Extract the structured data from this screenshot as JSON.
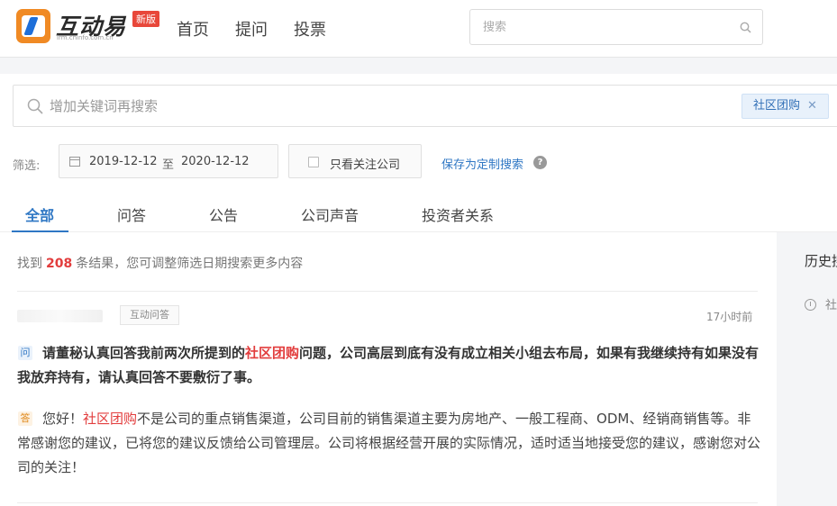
{
  "header": {
    "logo_text": "互动易",
    "logo_sub": "irm.cninfo.com.cn",
    "logo_badge": "新版",
    "nav": [
      "首页",
      "提问",
      "投票"
    ],
    "search_placeholder": "搜索"
  },
  "keyword_search": {
    "placeholder": "增加关键词再搜索",
    "tag": "社区团购",
    "tag_close": "✕"
  },
  "filter": {
    "label": "筛选:",
    "date_from": "2019-12-12",
    "date_sep": "至",
    "date_to": "2020-12-12",
    "follow_only": "只看关注公司",
    "save_link": "保存为定制搜索",
    "help": "?"
  },
  "tabs": [
    "全部",
    "问答",
    "公告",
    "公司声音",
    "投资者关系"
  ],
  "results": {
    "prefix": "找到",
    "count": "208",
    "suffix": "条结果，您可调整筛选日期搜索更多内容"
  },
  "item": {
    "source": "互动问答",
    "time": "17小时前",
    "q_icon": "问",
    "question_before": "请董秘认真回答我前两次所提到的",
    "question_keyword": "社区团购",
    "question_after": "问题，公司高层到底有没有成立相关小组去布局，如果有我继续持有如果没有我放弃持有，请认真回答不要敷衍了事。",
    "a_icon": "答",
    "answer_before": "您好！",
    "answer_keyword": "社区团购",
    "answer_after": "不是公司的重点销售渠道，公司目前的销售渠道主要为房地产、一般工程商、ODM、经销商销售等。非常感谢您的建议，已将您的建议反馈给公司管理层。公司将根据经营开展的实际情况，适时适当地接受您的建议，感谢您对公司的关注！"
  },
  "sidebar": {
    "title": "历史搜",
    "item": "社"
  },
  "colors": {
    "accent": "#2f77c4",
    "highlight": "#e23d3d",
    "logo_orange": "#f08a24"
  }
}
